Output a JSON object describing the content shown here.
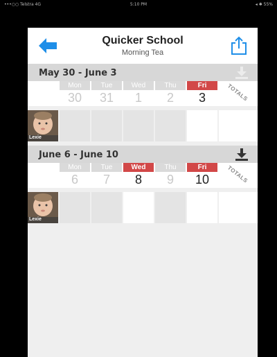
{
  "status": {
    "carrier": "•••○○ Telstra 4G",
    "time": "5:10 PM",
    "battery": "◂ ✱ 55%"
  },
  "app": {
    "title": "Quicker School",
    "subtitle": "Morning Tea",
    "accent": "#1e8ee8",
    "highlight": "#d24848"
  },
  "weeks": [
    {
      "label": "May 30 - June 3",
      "totals_label": "TOTALS",
      "days": [
        {
          "name": "Mon",
          "num": "30",
          "state": "muted"
        },
        {
          "name": "Tue",
          "num": "31",
          "state": "muted"
        },
        {
          "name": "Wed",
          "num": "1",
          "state": "muted"
        },
        {
          "name": "Thu",
          "num": "2",
          "state": "muted"
        },
        {
          "name": "Fri",
          "num": "3",
          "state": "hl"
        }
      ],
      "child": {
        "name": "Lexie"
      }
    },
    {
      "label": "June 6 - June 10",
      "totals_label": "TOTALS",
      "days": [
        {
          "name": "Mon",
          "num": "6",
          "state": "muted"
        },
        {
          "name": "Tue",
          "num": "7",
          "state": "muted"
        },
        {
          "name": "Wed",
          "num": "8",
          "state": "hl"
        },
        {
          "name": "Thu",
          "num": "9",
          "state": "muted"
        },
        {
          "name": "Fri",
          "num": "10",
          "state": "hl"
        }
      ],
      "child": {
        "name": "Lexie"
      }
    }
  ],
  "icons": {
    "back": "arrow-left-icon",
    "share": "share-icon",
    "download": "download-icon"
  }
}
